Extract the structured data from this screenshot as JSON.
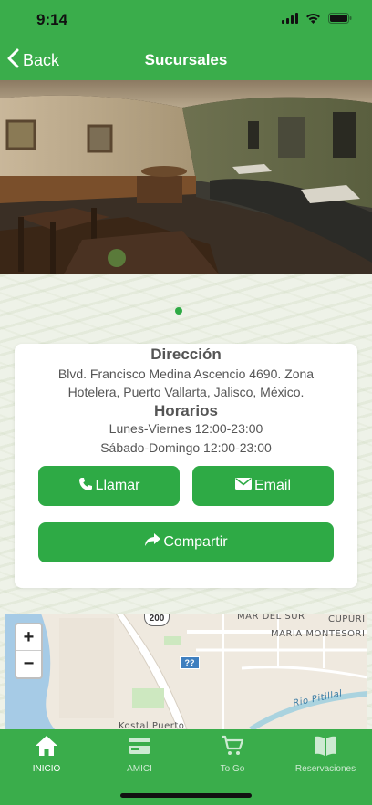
{
  "status_bar": {
    "time": "9:14"
  },
  "nav": {
    "back_label": "Back",
    "title": "Sucursales"
  },
  "carousel": {
    "page_count": 1,
    "current_page": 1
  },
  "info": {
    "address_heading": "Dirección",
    "address_line1": "Blvd. Francisco Medina Ascencio 4690. Zona",
    "address_line2": "Hotelera, Puerto Vallarta, Jalisco, México.",
    "hours_heading": "Horarios",
    "hours_weekdays": "Lunes-Viernes 12:00-23:00",
    "hours_weekend": "Sábado-Domingo 12:00-23:00"
  },
  "buttons": {
    "call": "Llamar",
    "email": "Email",
    "share": "Compartir"
  },
  "map": {
    "zoom_in": "+",
    "zoom_out": "−",
    "road_shield": "200",
    "labels": {
      "street_1": "MAR DEL SUR",
      "street_2": "CUPURI",
      "street_3": "MARIA MONTESORI",
      "river": "Rio Pitillal",
      "place": "Kostal Puerto"
    }
  },
  "tabs": [
    {
      "label": "INICIO",
      "icon": "home-icon",
      "active": true
    },
    {
      "label": "AMICI",
      "icon": "card-icon",
      "active": false
    },
    {
      "label": "To Go",
      "icon": "cart-icon",
      "active": false
    },
    {
      "label": "Reservaciones",
      "icon": "book-icon",
      "active": false
    }
  ],
  "colors": {
    "brand_green": "#3aad4b",
    "button_green": "#2eaa45",
    "heading_text": "#555555"
  }
}
